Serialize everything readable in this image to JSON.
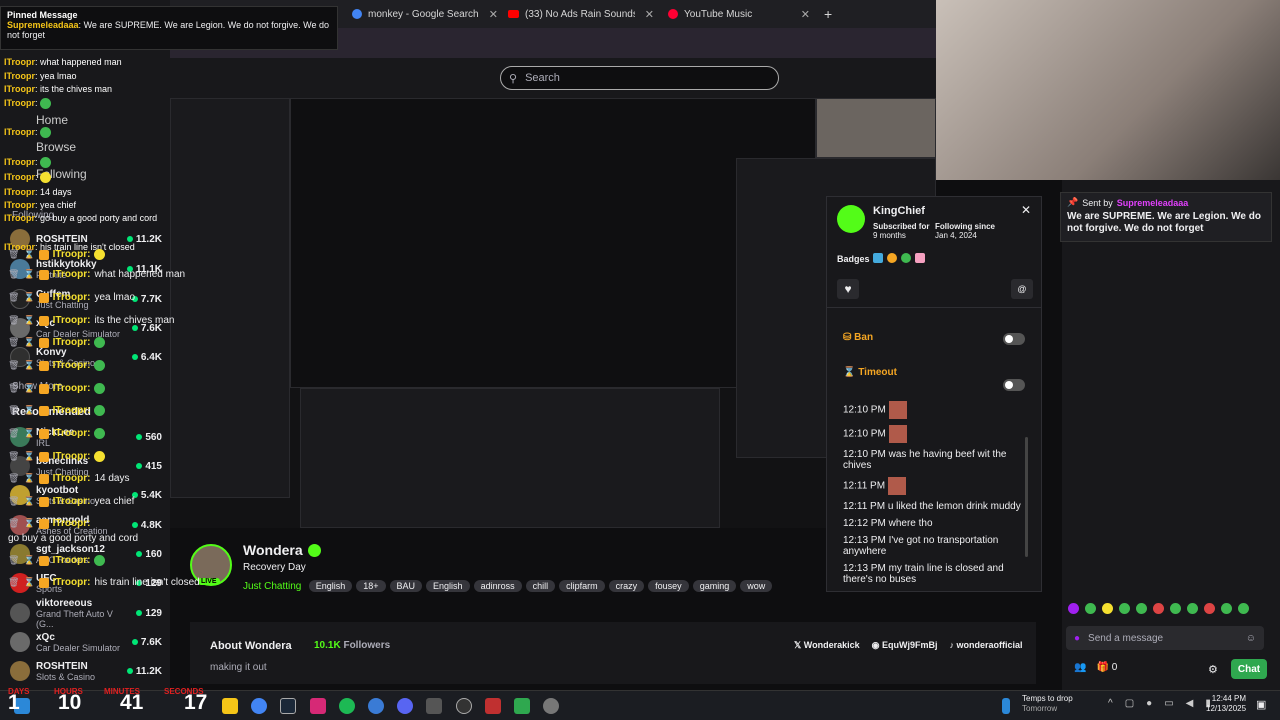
{
  "browser": {
    "tabs": [
      {
        "title": "monkey - Google Search"
      },
      {
        "title": "(33) No Ads Rain Sounds for Sle"
      },
      {
        "title": "YouTube Music"
      }
    ],
    "new_tab": "+"
  },
  "search": {
    "placeholder": "Search"
  },
  "pinned_left": {
    "title": "Pinned Message",
    "user": "Supremeleadaaa",
    "text": "We are SUPREME. We are Legion. We do not forgive. We do not forget"
  },
  "left_chat_lines": [
    {
      "user": "ITroopr",
      "text": "what happened man"
    },
    {
      "user": "ITroopr",
      "text": "yea lmao"
    },
    {
      "user": "ITroopr",
      "text": "its the chives man"
    },
    {
      "user": "ITroopr",
      "text": ""
    },
    {
      "user": "ITroopr",
      "text": ""
    },
    {
      "user": "ITroopr",
      "text": ""
    },
    {
      "user": "ITroopr",
      "text": ""
    },
    {
      "user": "ITroopr",
      "text": "14 days"
    },
    {
      "user": "ITroopr",
      "text": "yea chief"
    },
    {
      "user": "ITroopr",
      "text": "go buy a good porty and cord"
    },
    {
      "user": "ITroopr",
      "text": "his train line isn't closed"
    }
  ],
  "sidebar": {
    "nav": [
      "Home",
      "Browse",
      "Following"
    ],
    "following_header": "Following",
    "following": [
      {
        "name": "ROSHTEIN",
        "game": "",
        "viewers": "11.2K",
        "color": "#8a6d3b"
      },
      {
        "name": "hstikkytokky",
        "game": "Fortnite",
        "viewers": "11.1K",
        "color": "#4a7a9a"
      },
      {
        "name": "Cuffem",
        "game": "Just Chatting",
        "viewers": "7.7K",
        "color": "#222"
      },
      {
        "name": "xQc",
        "game": "Car Dealer Simulator",
        "viewers": "7.6K",
        "color": "#6a6a6a"
      },
      {
        "name": "Konvy",
        "game": "Slots & Casino",
        "viewers": "6.4K",
        "color": "#2f2f2f"
      }
    ],
    "show_more": "Show More",
    "recommended_header": "Recommended",
    "recommended": [
      {
        "name": "NickLee",
        "game": "IRL",
        "viewers": "560",
        "color": "#3a7a5a"
      },
      {
        "name": "boneclinks",
        "game": "Just Chatting",
        "viewers": "415",
        "color": "#444"
      },
      {
        "name": "kyootbot",
        "game": "Slots & Casino",
        "viewers": "5.4K",
        "color": "#c0a030"
      },
      {
        "name": "asmongold",
        "game": "Ashes of Creation",
        "viewers": "4.8K",
        "color": "#a05050"
      },
      {
        "name": "sgt_jackson12",
        "game": "ARC Raiders",
        "viewers": "160",
        "color": "#8a7a30"
      },
      {
        "name": "UFC",
        "game": "Sports",
        "viewers": "129",
        "color": "#d02020"
      },
      {
        "name": "viktoreeous",
        "game": "Grand Theft Auto V (G...",
        "viewers": "129",
        "color": "#555"
      },
      {
        "name": "xQc",
        "game": "Car Dealer Simulator",
        "viewers": "7.6K",
        "color": "#6a6a6a"
      },
      {
        "name": "ROSHTEIN",
        "game": "Slots & Casino",
        "viewers": "11.2K",
        "color": "#8a6d3b"
      }
    ]
  },
  "stream": {
    "name": "Wondera",
    "title": "Recovery Day",
    "category": "Just Chatting",
    "live": "LIVE",
    "tags": [
      "English",
      "18+",
      "BAU",
      "English",
      "adinross",
      "chill",
      "clipfarm",
      "crazy",
      "fousey",
      "gaming",
      "wow"
    ]
  },
  "about": {
    "title": "About Wondera",
    "followers": "10.1K",
    "followers_label": "Followers",
    "bio": "making it out",
    "links": [
      "Wonderakick",
      "EquWj9FmBj",
      "wonderaofficial"
    ]
  },
  "user_card": {
    "name": "KingChief",
    "subscribed_label": "Subscribed for",
    "subscribed_value": "9 months",
    "following_label": "Following since",
    "following_value": "Jan 4, 2024",
    "badges_label": "Badges",
    "ban_label": "Ban",
    "timeout_label": "Timeout",
    "messages": [
      {
        "time": "12:10 PM",
        "text": ""
      },
      {
        "time": "12:10 PM",
        "text": ""
      },
      {
        "time": "12:10 PM",
        "text": "was he having beef wit the chives"
      },
      {
        "time": "12:11 PM",
        "text": ""
      },
      {
        "time": "12:11 PM",
        "text": "u liked the lemon drink muddy"
      },
      {
        "time": "12:12 PM",
        "text": "where tho"
      },
      {
        "time": "12:13 PM",
        "text": "I've got no transportation anywhere"
      },
      {
        "time": "12:13 PM",
        "text": "my train line is closed and there's no buses"
      }
    ]
  },
  "right_chat": {
    "pinned": {
      "sent_by_label": "Sent by",
      "user": "Supremeleadaaa",
      "text": "We are SUPREME. We are Legion. We do not forgive. We do not forget"
    },
    "lines": [
      {
        "user": "ITroopr:",
        "text": "",
        "emote": "yellow"
      },
      {
        "user": "ITroopr:",
        "text": "what happened man",
        "emote": ""
      },
      {
        "user": "ITroopr:",
        "text": "yea lmao",
        "emote": ""
      },
      {
        "user": "ITroopr:",
        "text": "its the chives man",
        "emote": ""
      },
      {
        "user": "ITroopr:",
        "text": "",
        "emote": "green"
      },
      {
        "user": "ITroopr:",
        "text": "",
        "emote": "green"
      },
      {
        "user": "ITroopr:",
        "text": "",
        "emote": "green"
      },
      {
        "user": "ITroopr:",
        "text": "",
        "emote": "green"
      },
      {
        "user": "ITroopr:",
        "text": "",
        "emote": "yellow"
      },
      {
        "user": "ITroopr:",
        "text": "14 days",
        "emote": ""
      },
      {
        "user": "ITroopr:",
        "text": "yea chief",
        "emote": ""
      },
      {
        "user": "ITroopr:",
        "text": "go buy a good porty and cord",
        "emote": ""
      },
      {
        "user": "ITroopr:",
        "text": "",
        "emote": "green"
      },
      {
        "user": "ITroopr:",
        "text": "his train line isn't closed",
        "emote": ""
      }
    ],
    "send_placeholder": "Send a message",
    "points": "0",
    "chat_button": "Chat"
  },
  "taskbar": {
    "timer_labels": [
      "DAYS",
      "HOURS",
      "MINUTES",
      "SECONDS"
    ],
    "timer_values": [
      "1",
      "10",
      "41",
      "17"
    ],
    "notification_title": "Temps to drop",
    "notification_sub": "Tomorrow",
    "time": "12:44 PM",
    "date": "12/13/2025"
  },
  "colors": {
    "accent": "#53fc18",
    "chat_button": "#2fa84f",
    "timer_label": "#e02020"
  }
}
